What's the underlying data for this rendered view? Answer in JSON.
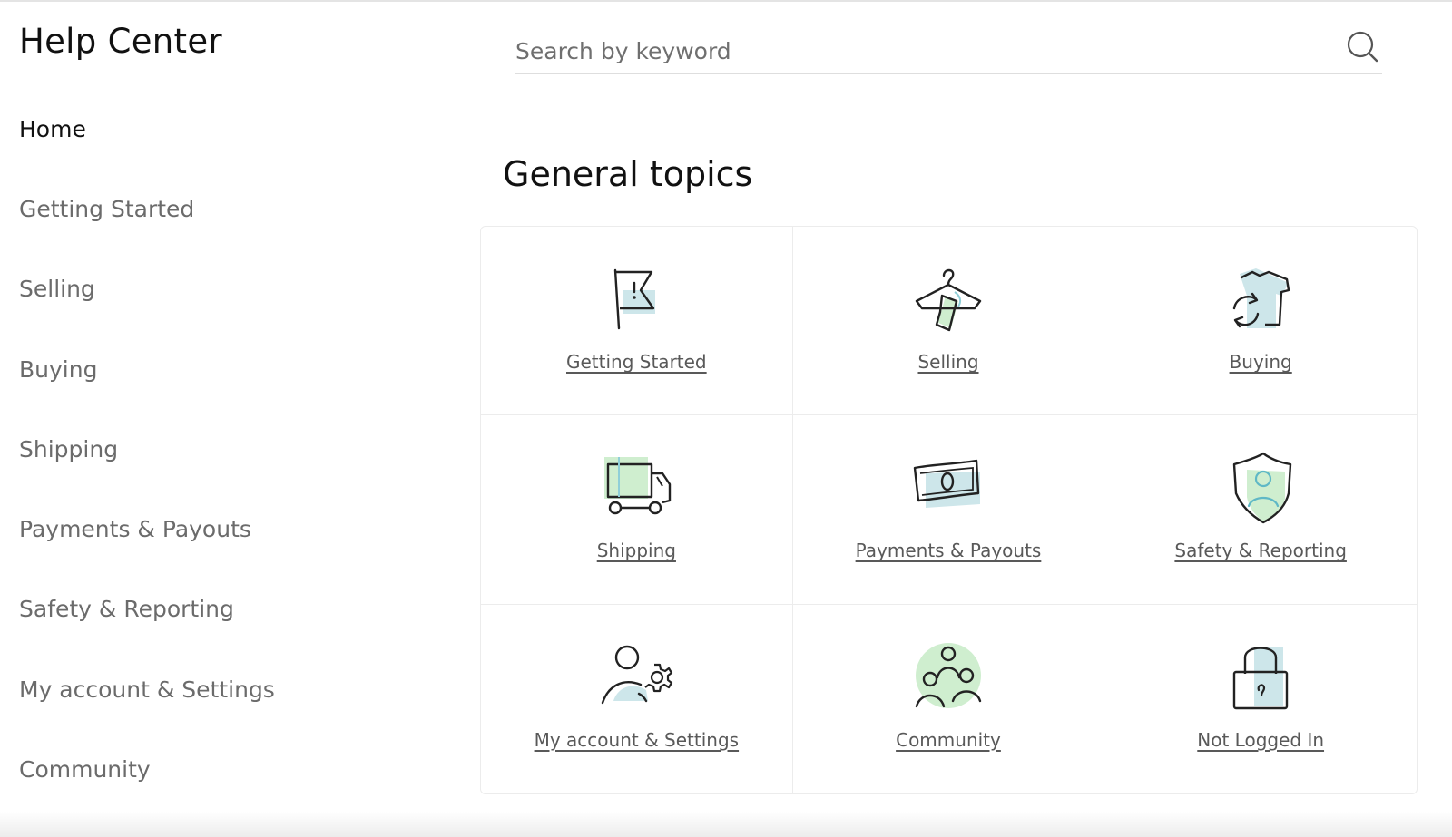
{
  "app": {
    "title": "Help Center"
  },
  "search": {
    "placeholder": "Search by keyword"
  },
  "sidebar": {
    "items": [
      {
        "label": "Home",
        "active": true
      },
      {
        "label": "Getting Started"
      },
      {
        "label": "Selling"
      },
      {
        "label": "Buying"
      },
      {
        "label": "Shipping"
      },
      {
        "label": "Payments & Payouts"
      },
      {
        "label": "Safety & Reporting"
      },
      {
        "label": "My account & Settings"
      },
      {
        "label": "Community"
      }
    ]
  },
  "main": {
    "section_title": "General topics",
    "topics": [
      {
        "label": "Getting Started",
        "icon": "flag-icon"
      },
      {
        "label": "Selling",
        "icon": "hanger-tag-icon"
      },
      {
        "label": "Buying",
        "icon": "tshirt-refresh-icon"
      },
      {
        "label": "Shipping",
        "icon": "truck-icon"
      },
      {
        "label": "Payments & Payouts",
        "icon": "banknote-icon"
      },
      {
        "label": "Safety & Reporting",
        "icon": "shield-user-icon"
      },
      {
        "label": "My account & Settings",
        "icon": "user-gear-icon"
      },
      {
        "label": "Community",
        "icon": "people-group-icon"
      },
      {
        "label": "Not Logged In",
        "icon": "padlock-icon"
      }
    ]
  },
  "colors": {
    "accent_green": "#cfeecf",
    "accent_blue": "#cde6ea",
    "text_muted": "#6b6b6b",
    "border": "#ececec"
  }
}
